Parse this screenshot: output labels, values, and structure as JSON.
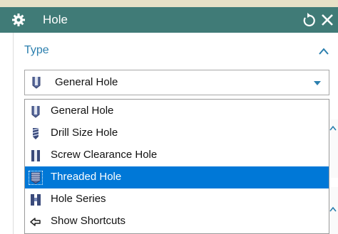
{
  "window": {
    "title": "Hole"
  },
  "type_section": {
    "label": "Type"
  },
  "type_select": {
    "value": "General Hole"
  },
  "dropdown": {
    "items": [
      {
        "label": "General Hole",
        "icon": "general-hole-icon"
      },
      {
        "label": "Drill Size Hole",
        "icon": "drill-size-hole-icon"
      },
      {
        "label": "Screw Clearance Hole",
        "icon": "screw-clearance-hole-icon"
      },
      {
        "label": "Threaded Hole",
        "icon": "threaded-hole-icon",
        "selected": true
      },
      {
        "label": "Hole Series",
        "icon": "hole-series-icon"
      },
      {
        "label": "Show Shortcuts",
        "icon": "arrow-left-icon"
      }
    ]
  },
  "colors": {
    "titlebar": "#407b77",
    "accent_text": "#2b7fae",
    "selection": "#0078d7"
  }
}
